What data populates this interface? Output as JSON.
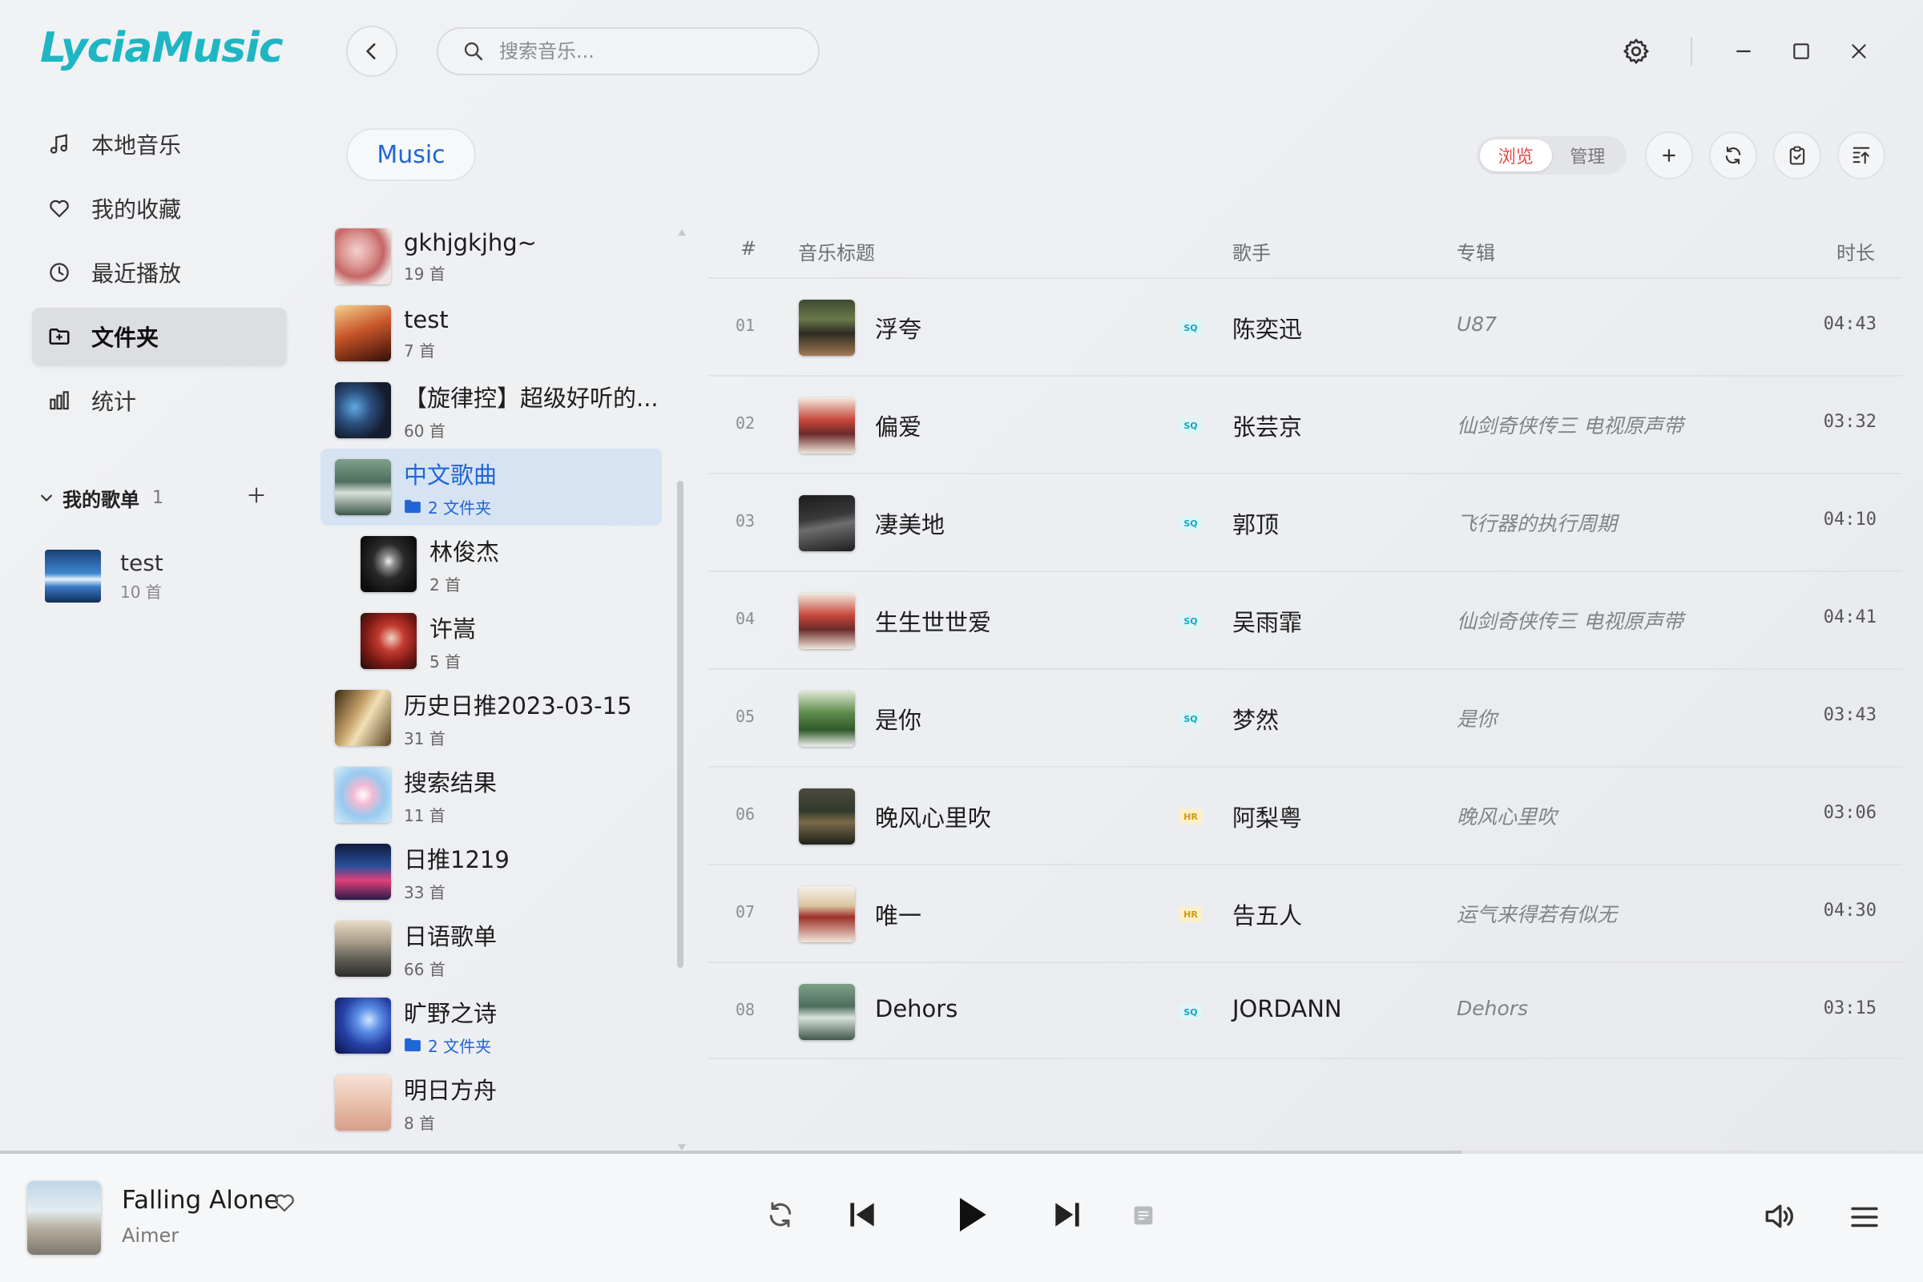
{
  "app": {
    "name": "LyciaMusic"
  },
  "search": {
    "placeholder": "搜索音乐..."
  },
  "sidebar": {
    "items": [
      {
        "label": "本地音乐",
        "icon": "music-note-icon"
      },
      {
        "label": "我的收藏",
        "icon": "heart-icon"
      },
      {
        "label": "最近播放",
        "icon": "clock-icon"
      },
      {
        "label": "文件夹",
        "icon": "folder-icon",
        "active": true
      },
      {
        "label": "统计",
        "icon": "bar-chart-icon"
      }
    ],
    "playlists_header": "我的歌单",
    "playlists_count": "1",
    "playlists": [
      {
        "name": "test",
        "count": "10 首"
      }
    ]
  },
  "folder_pane": {
    "chip": "Music",
    "folders": [
      {
        "name": "gkhjgkjhg~",
        "count": "19 首"
      },
      {
        "name": "test",
        "count": "7 首"
      },
      {
        "name": "【旋律控】超级好听的...",
        "count": "60 首"
      },
      {
        "name": "中文歌曲",
        "count": "2 文件夹",
        "active": true,
        "is_folder": true
      },
      {
        "name": "林俊杰",
        "count": "2 首",
        "sub": true
      },
      {
        "name": "许嵩",
        "count": "5 首",
        "sub": true
      },
      {
        "name": "历史日推2023-03-15",
        "count": "31 首"
      },
      {
        "name": "搜索结果",
        "count": "11 首"
      },
      {
        "name": "日推1219",
        "count": "33 首"
      },
      {
        "name": "日语歌单",
        "count": "66 首"
      },
      {
        "name": "旷野之诗",
        "count": "2 文件夹",
        "is_folder": true
      },
      {
        "name": "明日方舟",
        "count": "8 首"
      }
    ]
  },
  "toolbar": {
    "browse": "浏览",
    "manage": "管理"
  },
  "table": {
    "headers": {
      "num": "#",
      "title": "音乐标题",
      "artist": "歌手",
      "album": "专辑",
      "duration": "时长"
    },
    "rows": [
      {
        "num": "01",
        "title": "浮夸",
        "quality": "SQ",
        "artist": "陈奕迅",
        "album": "U87",
        "duration": "04:43"
      },
      {
        "num": "02",
        "title": "偏爱",
        "quality": "SQ",
        "artist": "张芸京",
        "album": "仙剑奇侠传三 电视原声带",
        "duration": "03:32"
      },
      {
        "num": "03",
        "title": "凄美地",
        "quality": "SQ",
        "artist": "郭顶",
        "album": "飞行器的执行周期",
        "duration": "04:10"
      },
      {
        "num": "04",
        "title": "生生世世爱",
        "quality": "SQ",
        "artist": "吴雨霏",
        "album": "仙剑奇侠传三 电视原声带",
        "duration": "04:41"
      },
      {
        "num": "05",
        "title": "是你",
        "quality": "SQ",
        "artist": "梦然",
        "album": "是你",
        "duration": "03:43"
      },
      {
        "num": "06",
        "title": "晚风心里吹",
        "quality": "HR",
        "artist": "阿梨粤",
        "album": "晚风心里吹",
        "duration": "03:06"
      },
      {
        "num": "07",
        "title": "唯一",
        "quality": "HR",
        "artist": "告五人",
        "album": "运气来得若有似无",
        "duration": "04:30"
      },
      {
        "num": "08",
        "title": "Dehors",
        "quality": "SQ",
        "artist": "JORDANN",
        "album": "Dehors",
        "duration": "03:15"
      }
    ]
  },
  "player": {
    "title": "Falling Alone",
    "artist": "Aimer",
    "progress": 0.76
  },
  "colors": {
    "accent": "#2166d6",
    "logo": "#1fb6c4",
    "browse_active": "#e24a4a",
    "sq": "#16a6c0",
    "hr": "#d49a10"
  }
}
